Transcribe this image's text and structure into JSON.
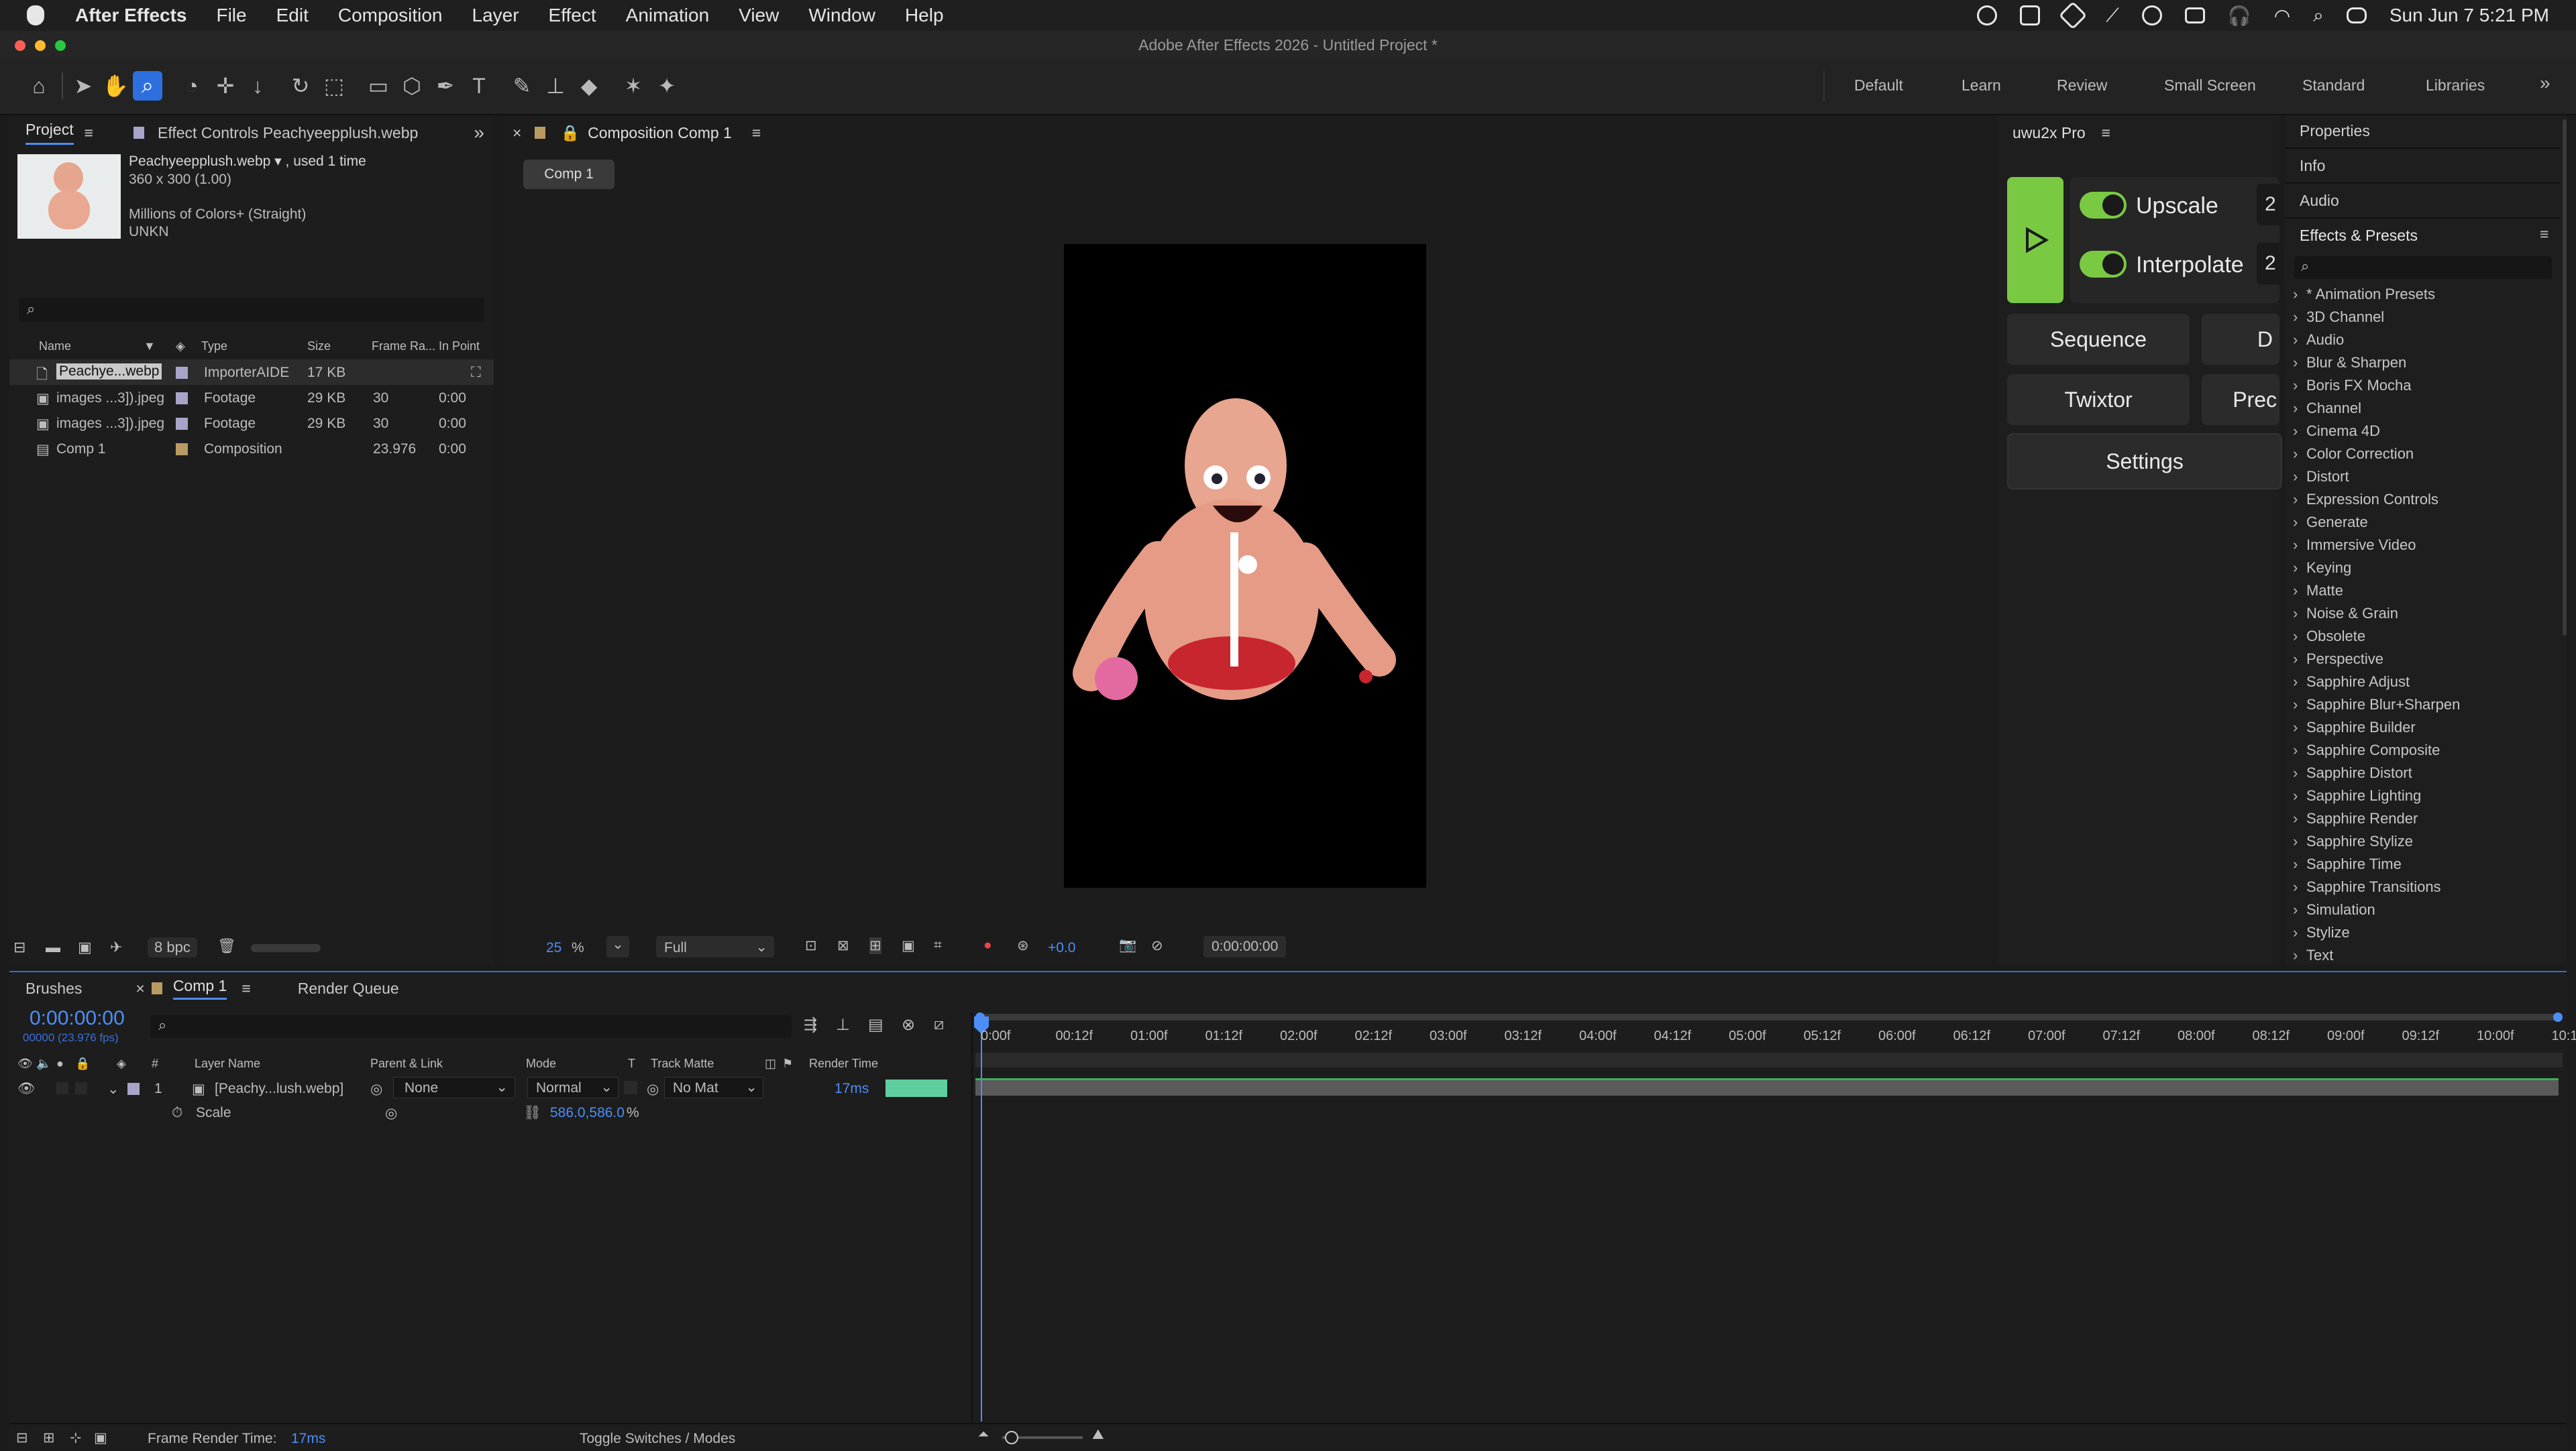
{
  "menubar": {
    "app": "After Effects",
    "items": [
      "File",
      "Edit",
      "Composition",
      "Layer",
      "Effect",
      "Animation",
      "View",
      "Window",
      "Help"
    ],
    "datetime": "Sun Jun 7  5:21 PM"
  },
  "window_title": "Adobe After Effects 2026 - Untitled Project *",
  "workspaces": [
    "Default",
    "Learn",
    "Review",
    "Small Screen",
    "Standard",
    "Libraries"
  ],
  "project_panel": {
    "tab_project": "Project",
    "tab_effect_controls": "Effect Controls Peachyeepplush.webp",
    "asset_name": "Peachyeepplush.webp ▾ , used 1 time",
    "asset_dims": "360 x 300 (1.00)",
    "asset_colors": "Millions of Colors+ (Straight)",
    "asset_codec": "UNKN",
    "columns": {
      "name": "Name",
      "type": "Type",
      "size": "Size",
      "frame_rate": "Frame Ra...",
      "in_point": "In Point"
    },
    "items": [
      {
        "name": "Peachye...webp",
        "type": "ImporterAIDE",
        "size": "17 KB",
        "fr": "",
        "in": ""
      },
      {
        "name": "images ...3]).jpeg",
        "type": "Footage",
        "size": "29 KB",
        "fr": "30",
        "in": "0:00"
      },
      {
        "name": "images ...3]).jpeg",
        "type": "Footage",
        "size": "29 KB",
        "fr": "30",
        "in": "0:00"
      },
      {
        "name": "Comp 1",
        "type": "Composition",
        "size": "",
        "fr": "23.976",
        "in": "0:00"
      }
    ],
    "bpc": "8 bpc"
  },
  "comp_panel": {
    "tab": "Composition Comp 1",
    "comp_button": "Comp 1",
    "zoom": "25",
    "zoom_unit": "%",
    "resolution": "Full",
    "exposure": "+0.0",
    "timecode": "0:00:00:00"
  },
  "uwu_panel": {
    "title": "uwu2x Pro",
    "upscale": "Upscale",
    "interpolate": "Interpolate",
    "sequence": "Sequence",
    "twixtor": "Twixtor",
    "prec": "Prec",
    "d": "D",
    "settings": "Settings",
    "partial_2a": "2",
    "partial_2b": "2"
  },
  "right_panel": {
    "properties": "Properties",
    "info": "Info",
    "audio": "Audio",
    "effects_presets": "Effects & Presets",
    "effects": [
      "* Animation Presets",
      "3D Channel",
      "Audio",
      "Blur & Sharpen",
      "Boris FX Mocha",
      "Channel",
      "Cinema 4D",
      "Color Correction",
      "Distort",
      "Expression Controls",
      "Generate",
      "Immersive Video",
      "Keying",
      "Matte",
      "Noise & Grain",
      "Obsolete",
      "Perspective",
      "Sapphire Adjust",
      "Sapphire Blur+Sharpen",
      "Sapphire Builder",
      "Sapphire Composite",
      "Sapphire Distort",
      "Sapphire Lighting",
      "Sapphire Render",
      "Sapphire Stylize",
      "Sapphire Time",
      "Sapphire Transitions",
      "Simulation",
      "Stylize",
      "Text"
    ]
  },
  "timeline": {
    "tab_brushes": "Brushes",
    "tab_comp": "Comp 1",
    "tab_render_queue": "Render Queue",
    "timecode": "0:00:00:00",
    "fps": "00000 (23.976 fps)",
    "columns": {
      "layer_name": "Layer Name",
      "parent": "Parent & Link",
      "mode": "Mode",
      "t": "T",
      "track_matte": "Track Matte",
      "render_time": "Render Time"
    },
    "layer": {
      "num": "1",
      "name": "[Peachy...lush.webp]",
      "parent": "None",
      "mode": "Normal",
      "track_matte": "No Mat",
      "render_time": "17ms"
    },
    "property": {
      "name": "Scale",
      "value": "586.0,586.0",
      "unit": "%"
    },
    "ruler": [
      "0:00f",
      "00:12f",
      "01:00f",
      "01:12f",
      "02:00f",
      "02:12f",
      "03:00f",
      "03:12f",
      "04:00f",
      "04:12f",
      "05:00f",
      "05:12f",
      "06:00f",
      "06:12f",
      "07:00f",
      "07:12f",
      "08:00f",
      "08:12f",
      "09:00f",
      "09:12f",
      "10:00f",
      "10:1"
    ],
    "footer_label": "Frame Render Time:",
    "footer_value": "17ms",
    "toggle_label": "Toggle Switches / Modes",
    "hash": "#"
  },
  "colors": {
    "accent_blue": "#4d8ef6",
    "green": "#7ac943",
    "label_purple": "#a8a3c9",
    "label_tan": "#b99a63"
  }
}
